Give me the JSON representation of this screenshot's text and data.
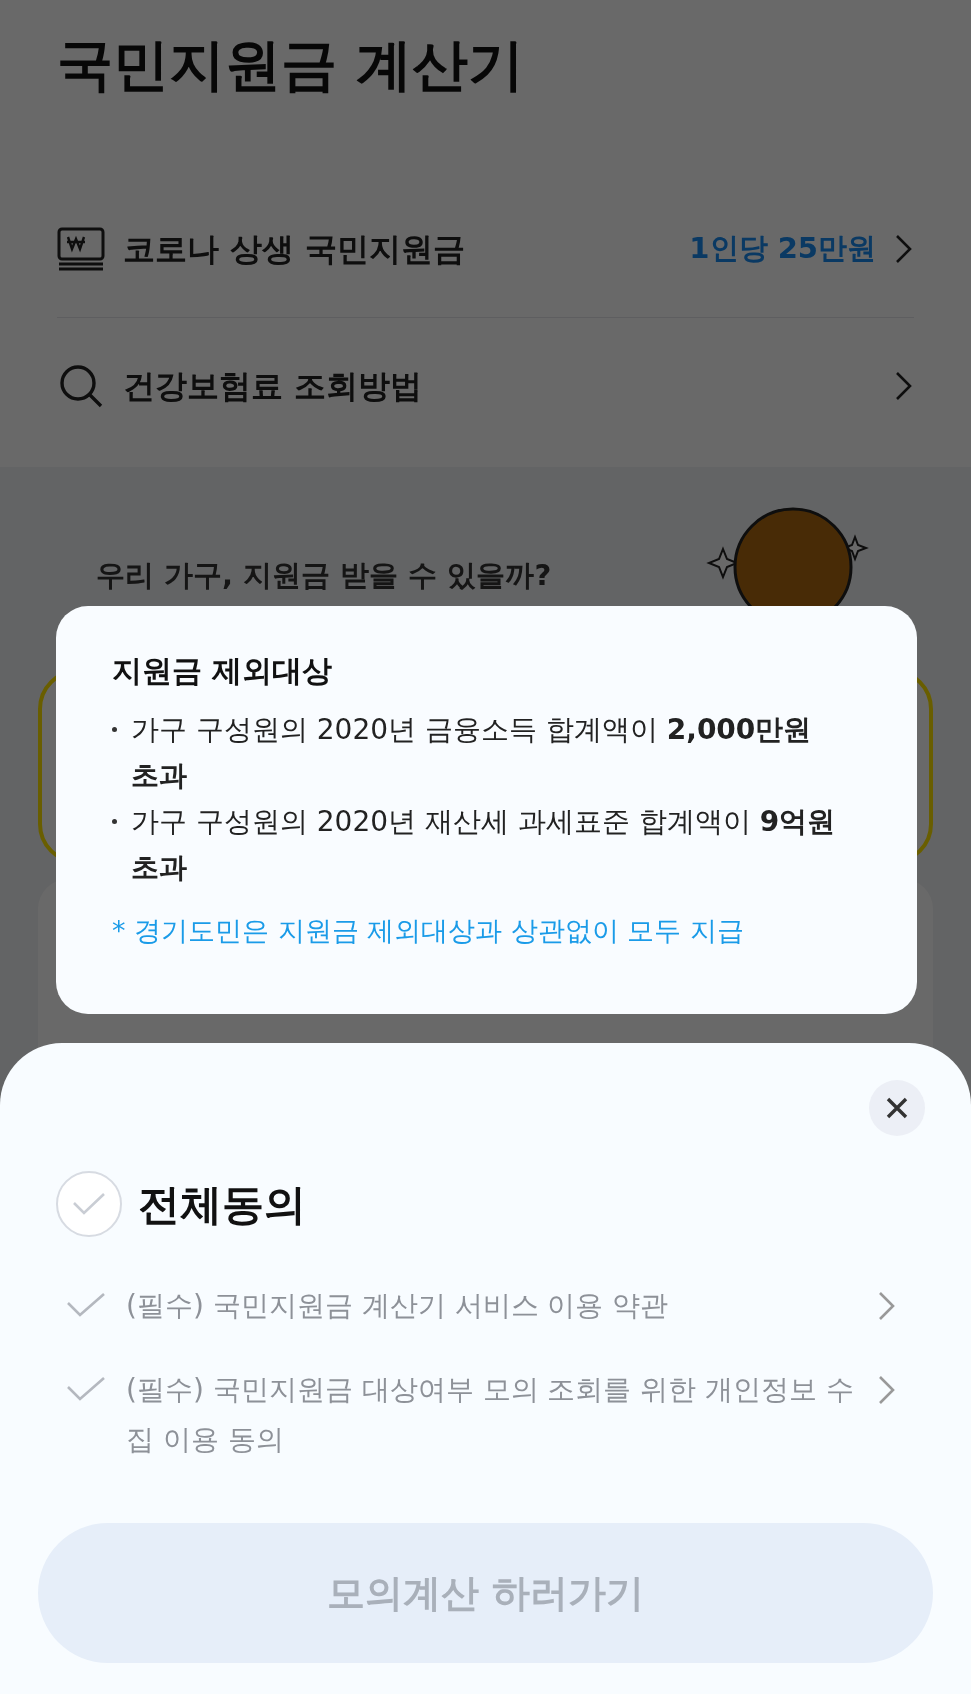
{
  "page": {
    "title": "국민지원금 계산기",
    "menu": [
      {
        "kind": "won",
        "label": "코로나 상생 국민지원금",
        "value": "1인당 25만원"
      },
      {
        "kind": "search",
        "label": "건강보험료 조회방법"
      }
    ],
    "section_title": "우리 가구, 지원금 받을 수 있을까?"
  },
  "tooltip": {
    "title": "지원금 제외대상",
    "bullets": [
      "가구 구성원의 2020년 금융소득 합계액이 **2,000만원 초과**",
      "가구 구성원의 2020년 재산세 과세표준 합계액이 **9억원 초과**"
    ],
    "note": "* 경기도민은 지원금 제외대상과 상관없이 모두 지급"
  },
  "sheet": {
    "agree_all": {
      "label": "전체동의",
      "checked": false
    },
    "terms": [
      {
        "label": "(필수) 국민지원금 계산기 서비스 이용 약관",
        "checked": false
      },
      {
        "label": "(필수) 국민지원금 대상여부 모의 조회를 위한 개인정보 수집 이용 동의",
        "checked": false
      }
    ],
    "button": {
      "label": "모의계산 하러가기",
      "disabled": true
    }
  }
}
